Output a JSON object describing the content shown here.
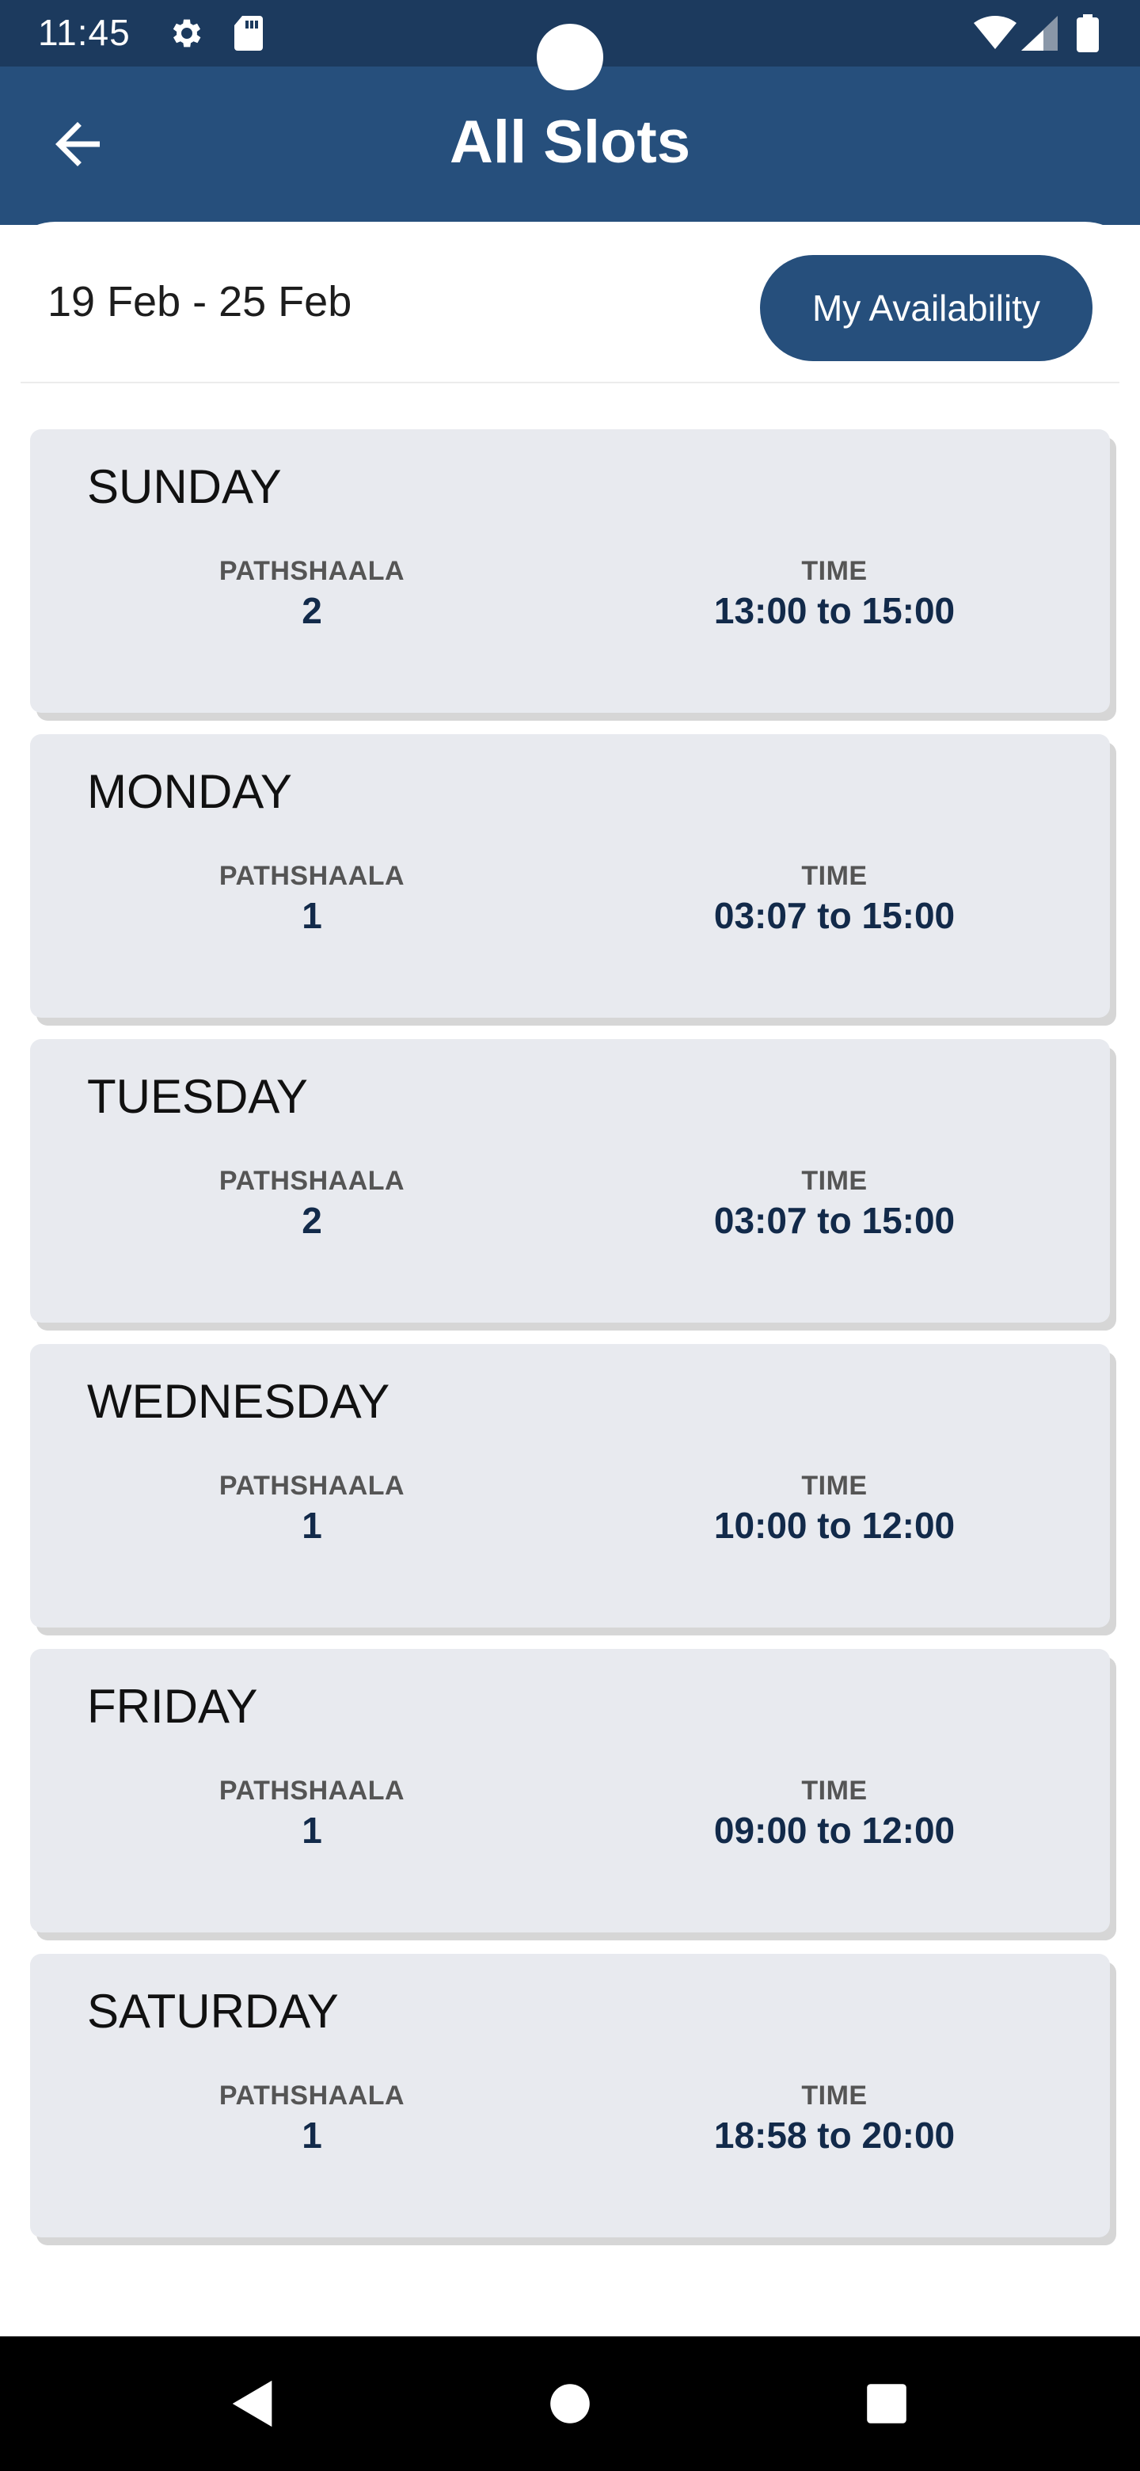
{
  "status_bar": {
    "time": "11:45",
    "icons": [
      "gear-icon",
      "sd-card-icon",
      "wifi-icon",
      "signal-icon",
      "battery-icon"
    ]
  },
  "app_bar": {
    "title": "All Slots",
    "back_icon": "arrow-left-icon"
  },
  "header": {
    "week_range": "19 Feb - 25 Feb",
    "availability_button": "My Availability"
  },
  "slots": [
    {
      "day": "SUNDAY",
      "pathshaala_label": "PATHSHAALA",
      "pathshaala": "2",
      "time_label": "TIME",
      "time": "13:00 to 15:00"
    },
    {
      "day": "MONDAY",
      "pathshaala_label": "PATHSHAALA",
      "pathshaala": "1",
      "time_label": "TIME",
      "time": "03:07 to 15:00"
    },
    {
      "day": "TUESDAY",
      "pathshaala_label": "PATHSHAALA",
      "pathshaala": "2",
      "time_label": "TIME",
      "time": "03:07 to 15:00"
    },
    {
      "day": "WEDNESDAY",
      "pathshaala_label": "PATHSHAALA",
      "pathshaala": "1",
      "time_label": "TIME",
      "time": "10:00 to 12:00"
    },
    {
      "day": "FRIDAY",
      "pathshaala_label": "PATHSHAALA",
      "pathshaala": "1",
      "time_label": "TIME",
      "time": "09:00 to 12:00"
    },
    {
      "day": "SATURDAY",
      "pathshaala_label": "PATHSHAALA",
      "pathshaala": "1",
      "time_label": "TIME",
      "time": "18:58 to 20:00"
    }
  ],
  "colors": {
    "status_bar": "#1c3a5e",
    "app_bar": "#264f7c",
    "card_bg": "#e8eaef",
    "value_text": "#122a4a"
  },
  "nav_bar": {
    "icons": [
      "back-triangle-icon",
      "home-circle-icon",
      "recents-square-icon"
    ]
  }
}
